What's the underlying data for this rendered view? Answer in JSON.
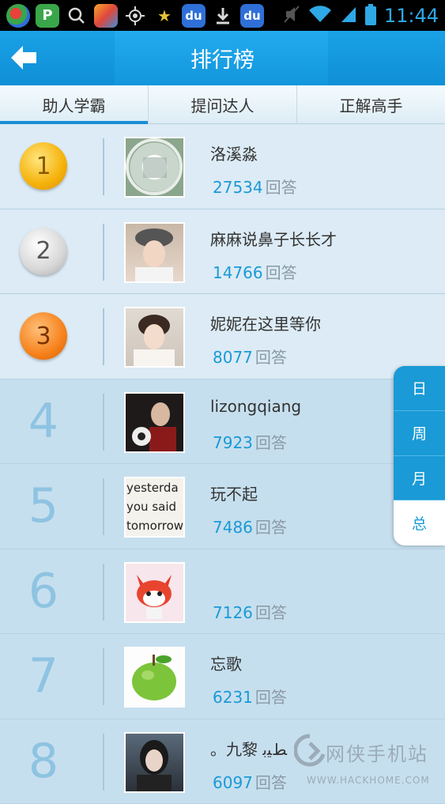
{
  "status_bar": {
    "time": "11:44",
    "baidu_label": "du",
    "app2_label": "P"
  },
  "header": {
    "title": "排行榜"
  },
  "tabs": [
    {
      "label": "助人学霸",
      "active": true
    },
    {
      "label": "提问达人",
      "active": false
    },
    {
      "label": "正解高手",
      "active": false
    }
  ],
  "answer_unit": "回答",
  "ranking": [
    {
      "rank": "1",
      "name": "洛溪淼",
      "count": "27534",
      "medal": "gold",
      "avatar": "avatar-photo"
    },
    {
      "rank": "2",
      "name": "麻麻说鼻子长长才",
      "count": "14766",
      "medal": "silver",
      "avatar": "avatar-photo"
    },
    {
      "rank": "3",
      "name": "妮妮在这里等你",
      "count": "8077",
      "medal": "bronze",
      "avatar": "avatar-photo"
    },
    {
      "rank": "4",
      "name": "lizongqiang",
      "count": "7923",
      "medal": "",
      "avatar": "avatar-photo"
    },
    {
      "rank": "5",
      "name": "玩不起",
      "count": "7486",
      "medal": "",
      "avatar": "avatar-text",
      "avatar_text": [
        "yesterda",
        "you said",
        "tomorrow"
      ]
    },
    {
      "rank": "6",
      "name": "",
      "count": "7126",
      "medal": "",
      "avatar": "avatar-cartoon-fox"
    },
    {
      "rank": "7",
      "name": "忘歌",
      "count": "6231",
      "medal": "",
      "avatar": "avatar-green-apple"
    },
    {
      "rank": "8",
      "name": "。九黎 ﻂﻴﺑ",
      "count": "6097",
      "medal": "",
      "avatar": "avatar-photo"
    }
  ],
  "period_selector": [
    {
      "label": "日",
      "active": false
    },
    {
      "label": "周",
      "active": false
    },
    {
      "label": "月",
      "active": false
    },
    {
      "label": "总",
      "active": true
    }
  ],
  "watermark": {
    "text": "网侠手机站",
    "url": "WWW.HACKHOME.COM"
  },
  "colors": {
    "accent": "#1a9ad6",
    "header": "#1296dc",
    "list_top": "#dcebf5",
    "list_rest": "#c6dfee",
    "rank_number": "#8ec3e2"
  }
}
